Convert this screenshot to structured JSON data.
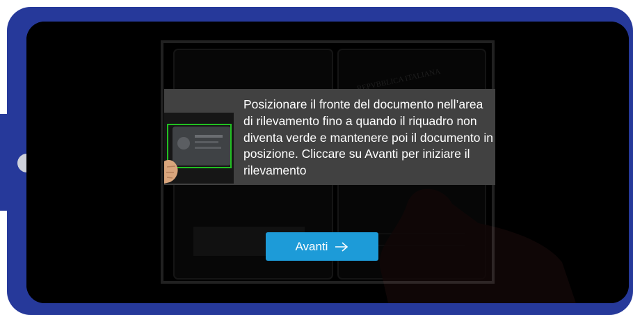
{
  "instruction": {
    "text": "Posizionare il fronte del documento nell’area di rilevamento fino a quando il riquadro non diventa verde e mantenere poi il documento in posizione. Cliccare su Avanti per iniziare il rilevamento"
  },
  "actions": {
    "next_label": "Avanti"
  },
  "document_background": {
    "header_text": "REPVBBLICA ITALIANA"
  },
  "icons": {
    "next_icon": "arrow-right-icon",
    "thumbnail": "document-scan-example-icon"
  },
  "colors": {
    "frame": "#26399a",
    "button": "#1d9bd8",
    "scan_box": "#22c022",
    "panel": "#414141"
  }
}
